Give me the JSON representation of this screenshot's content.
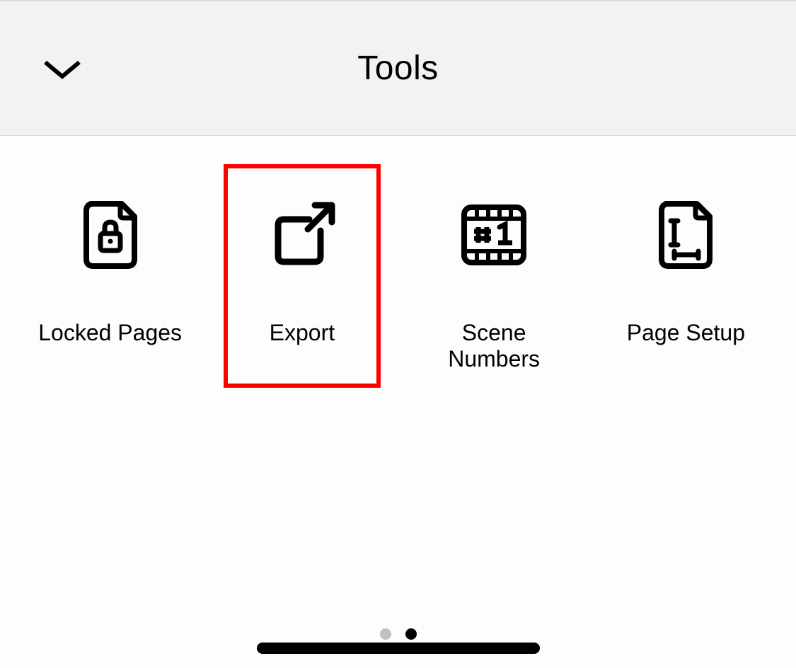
{
  "header": {
    "title": "Tools"
  },
  "tools": [
    {
      "label": "Locked Pages",
      "icon": "locked-pages-icon",
      "highlighted": false
    },
    {
      "label": "Export",
      "icon": "export-icon",
      "highlighted": true
    },
    {
      "label": "Scene Numbers",
      "icon": "scene-numbers-icon",
      "highlighted": false
    },
    {
      "label": "Page Setup",
      "icon": "page-setup-icon",
      "highlighted": false
    }
  ],
  "pagination": {
    "current": 2,
    "total": 2
  }
}
